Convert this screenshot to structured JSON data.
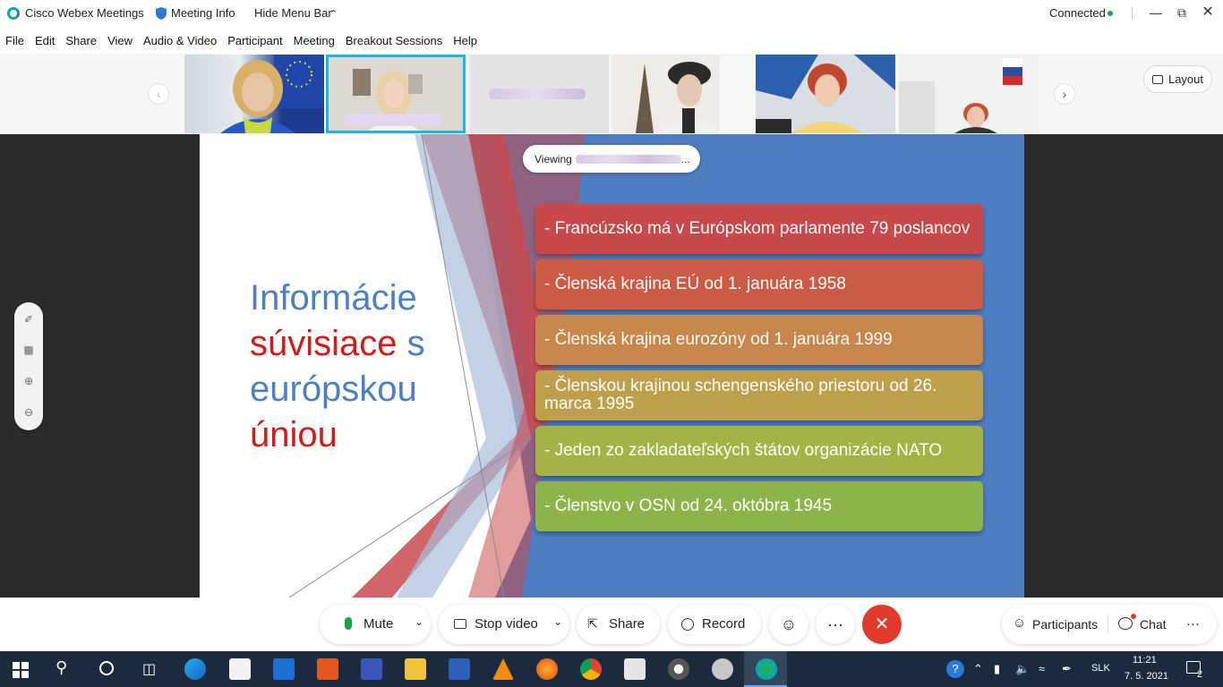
{
  "titlebar": {
    "app_title": "Cisco Webex Meetings",
    "meeting_info": "Meeting Info",
    "hide_menu_bar": "Hide Menu Bar",
    "status": "Connected",
    "status_color": "#1aa34a"
  },
  "menu": [
    "File",
    "Edit",
    "Share",
    "View",
    "Audio & Video",
    "Participant",
    "Meeting",
    "Breakout Sessions",
    "Help"
  ],
  "thumbnails": {
    "layout_label": "Layout",
    "active_index": 1
  },
  "viewing": {
    "prefix": "Viewing",
    "suffix": "..."
  },
  "slide": {
    "title_lines": [
      {
        "text": "Informácie",
        "color": "#4d7fc2"
      },
      {
        "text": "súvisiace",
        "color": "#d11c1c",
        "tail": " s",
        "tail_color": "#4d7fc2"
      },
      {
        "text": "európskou",
        "color": "#4d7fc2"
      },
      {
        "text": "úniou",
        "color": "#d11c1c"
      }
    ],
    "bullets": [
      {
        "text": "- Francúzsko má v Európskom parlamente 79 poslancov",
        "color": "#c9484a"
      },
      {
        "text": "- Členská krajina EÚ od 1. januára 1958",
        "color": "#cc5b46"
      },
      {
        "text": "- Členská krajina eurozóny od 1. januára 1999",
        "color": "#c7874c"
      },
      {
        "text": "- Členskou krajinou schengenského priestoru od 26. marca 1995",
        "color": "#bea04c"
      },
      {
        "text": "- Jeden zo zakladateľských štátov organizácie NATO",
        "color": "#a4b246"
      },
      {
        "text": "- Členstvo v OSN od 24. októbra 1945",
        "color": "#8cb44a"
      }
    ],
    "colors": {
      "panel_blue": "#4e7cc1",
      "stripe_red": "#c84b4f"
    }
  },
  "controls": {
    "mute": "Mute",
    "stop_video": "Stop video",
    "share": "Share",
    "record": "Record",
    "more": "···",
    "end": "✕",
    "participants": "Participants",
    "chat": "Chat",
    "end_color": "#e23b2d"
  },
  "taskbar": {
    "lang": "SLK",
    "time": "11:21",
    "date": "7. 5. 2021",
    "notification_count": "2"
  }
}
